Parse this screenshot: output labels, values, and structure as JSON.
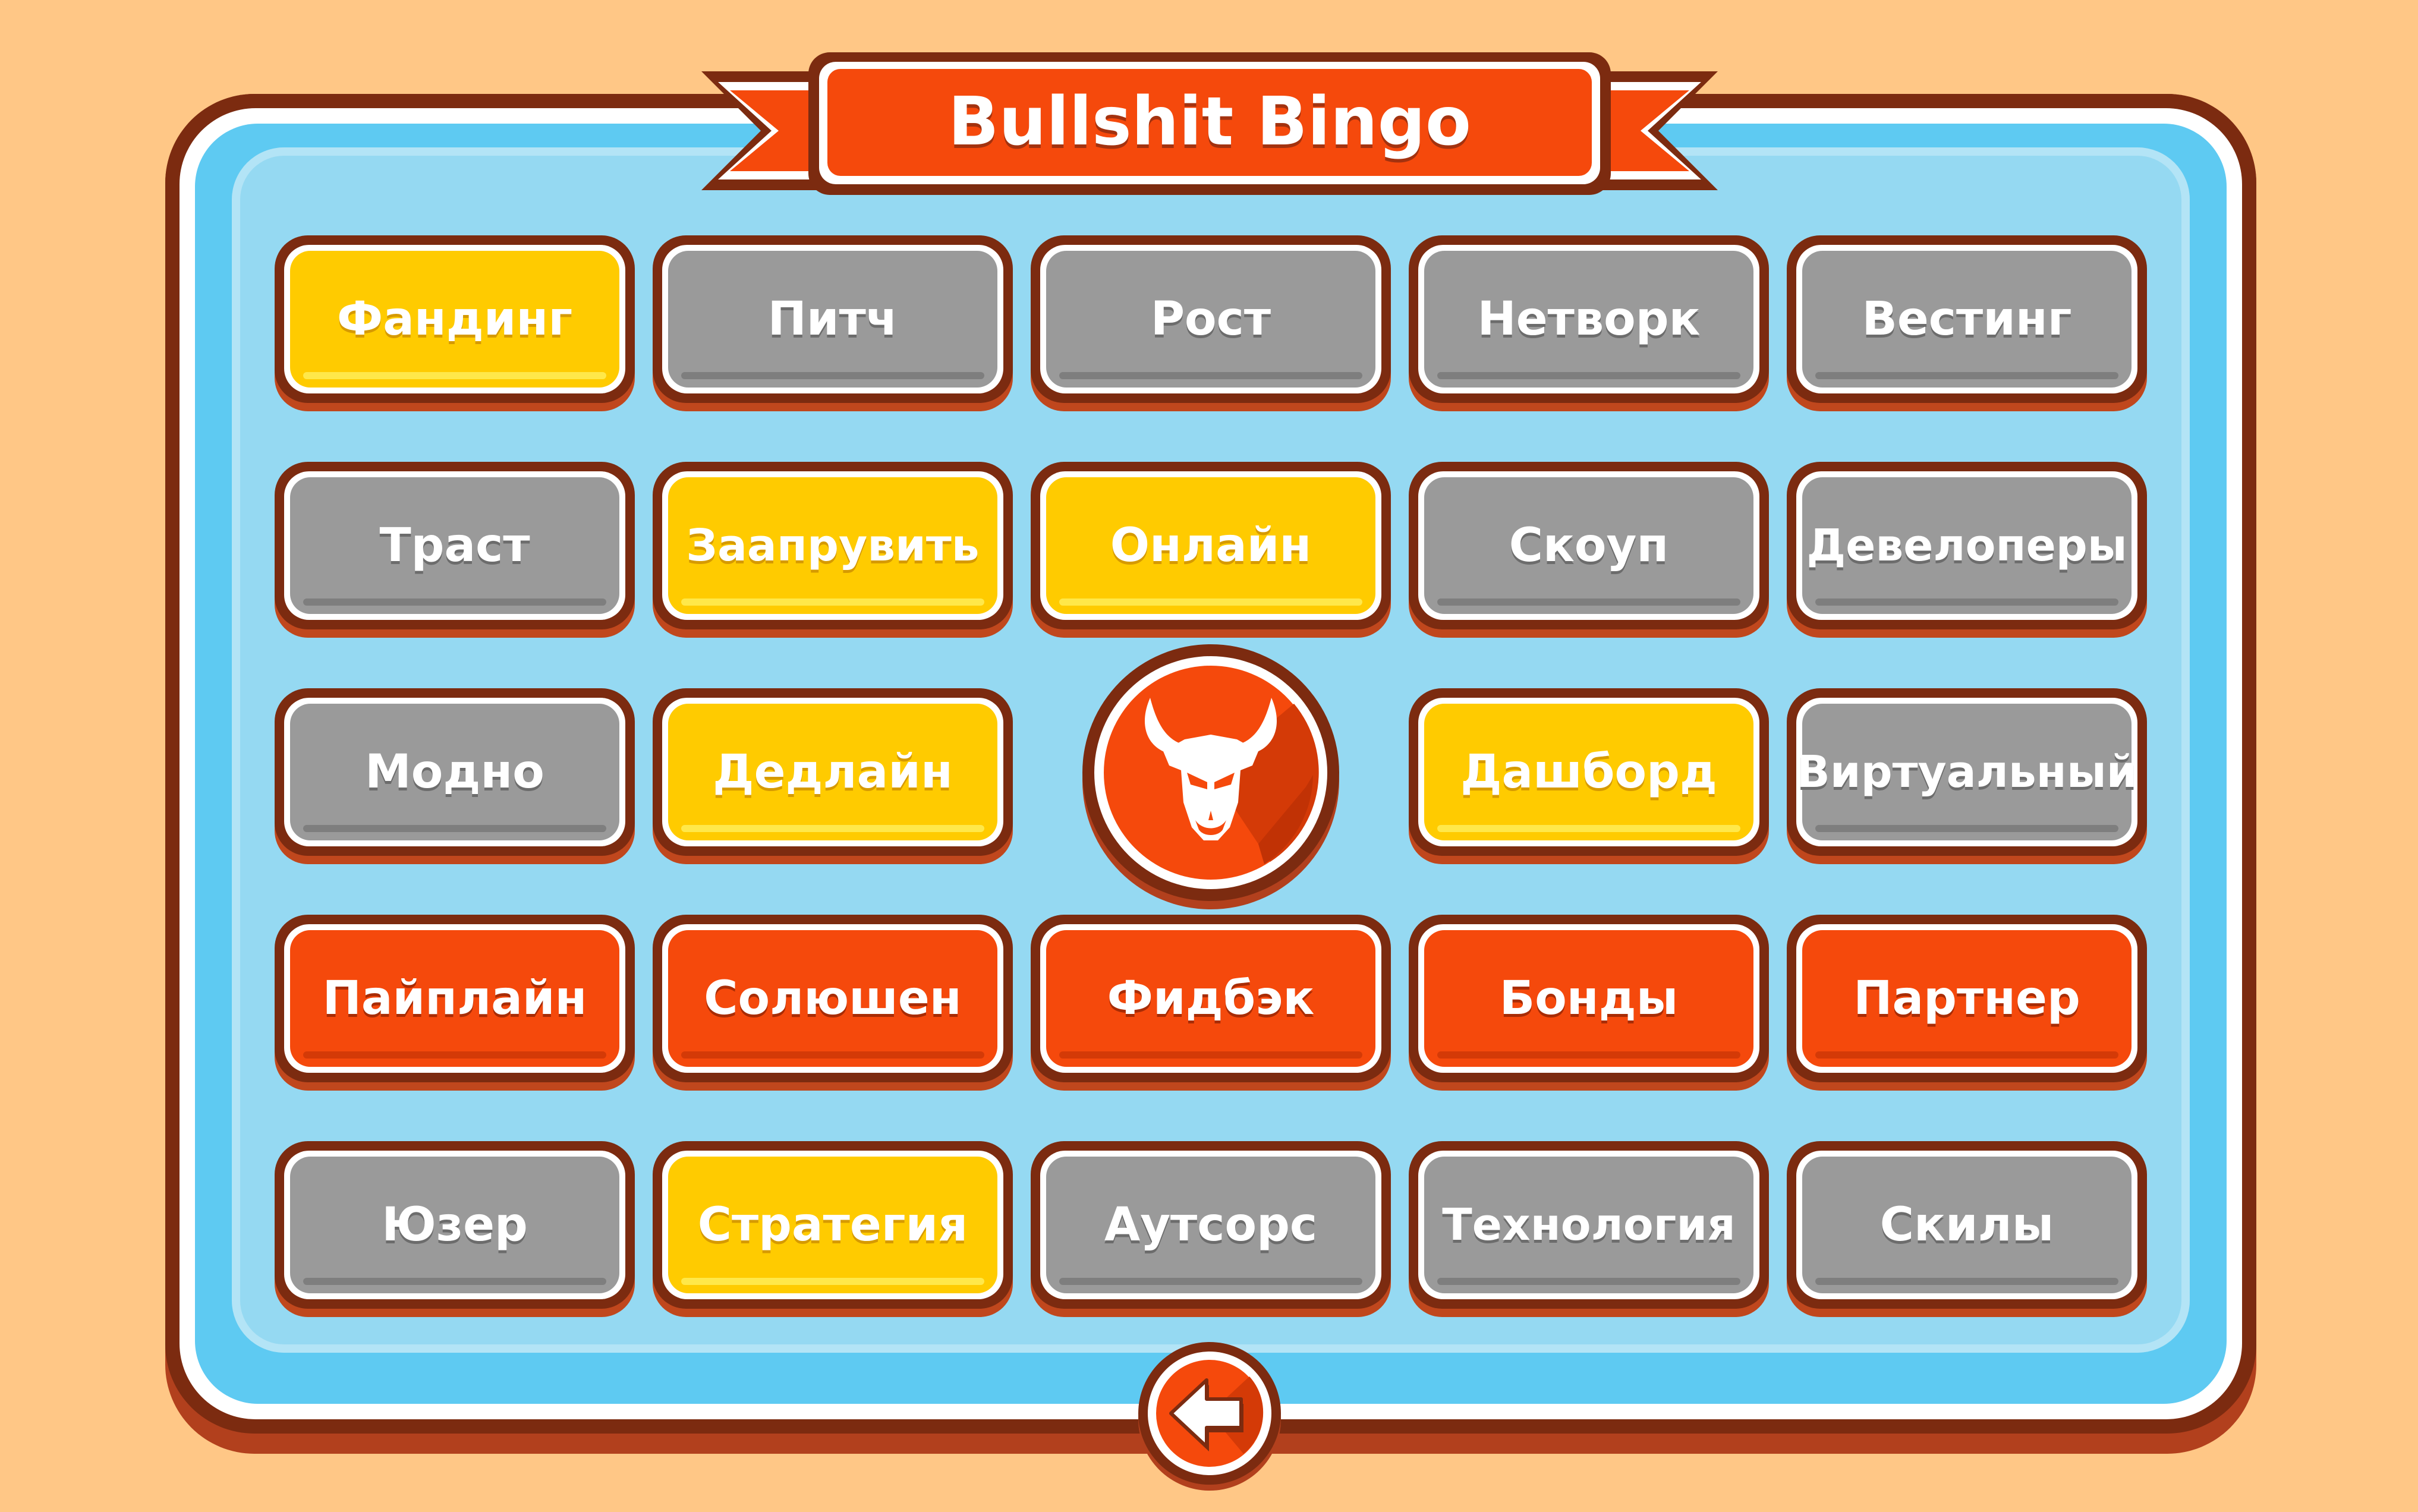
{
  "title": "Bullshit Bingo",
  "colors": {
    "background": "#ffc786",
    "board_frame": "#7c2b10",
    "board_blue": "#5ecaf2",
    "board_inner": "#95d9f2",
    "tile_unmarked": "#9a9a9a",
    "tile_marked": "#ffcb00",
    "tile_bingo": "#f5490c",
    "accent": "#f5490c"
  },
  "grid": [
    [
      {
        "label": "Фандинг",
        "state": "marked"
      },
      {
        "label": "Питч",
        "state": "unmarked"
      },
      {
        "label": "Рост",
        "state": "unmarked"
      },
      {
        "label": "Нетворк",
        "state": "unmarked"
      },
      {
        "label": "Вестинг",
        "state": "unmarked"
      }
    ],
    [
      {
        "label": "Траст",
        "state": "unmarked"
      },
      {
        "label": "Заапрувить",
        "state": "marked"
      },
      {
        "label": "Онлайн",
        "state": "marked"
      },
      {
        "label": "Скоуп",
        "state": "unmarked"
      },
      {
        "label": "Девелоперы",
        "state": "unmarked"
      }
    ],
    [
      {
        "label": "Модно",
        "state": "unmarked"
      },
      {
        "label": "Дедлайн",
        "state": "marked"
      },
      {
        "label": "",
        "state": "center",
        "icon": "bull-head-icon"
      },
      {
        "label": "Дашборд",
        "state": "marked"
      },
      {
        "label": "Виртуальный",
        "state": "unmarked"
      }
    ],
    [
      {
        "label": "Пайплайн",
        "state": "bingo"
      },
      {
        "label": "Солюшен",
        "state": "bingo"
      },
      {
        "label": "Фидбэк",
        "state": "bingo"
      },
      {
        "label": "Бонды",
        "state": "bingo"
      },
      {
        "label": "Партнер",
        "state": "bingo"
      }
    ],
    [
      {
        "label": "Юзер",
        "state": "unmarked"
      },
      {
        "label": "Стратегия",
        "state": "marked"
      },
      {
        "label": "Аутсорс",
        "state": "unmarked"
      },
      {
        "label": "Технология",
        "state": "unmarked"
      },
      {
        "label": "Скилы",
        "state": "unmarked"
      }
    ]
  ],
  "back_button": {
    "icon": "back-arrow-icon"
  }
}
